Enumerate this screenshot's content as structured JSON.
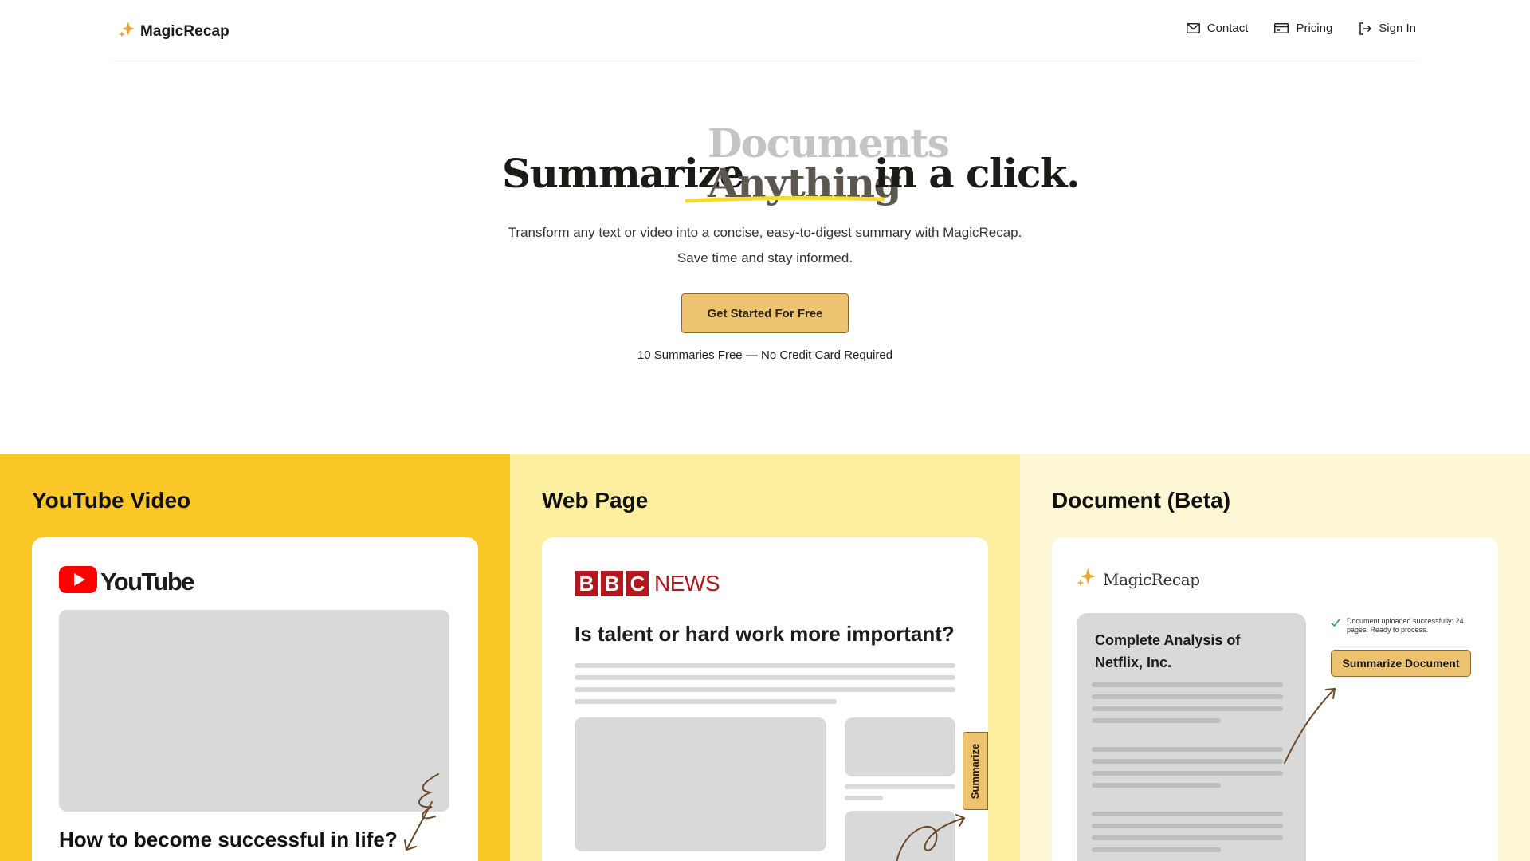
{
  "brand": {
    "name": "MagicRecap"
  },
  "nav": [
    {
      "label": "Contact",
      "icon": "mail-icon"
    },
    {
      "label": "Pricing",
      "icon": "credit-card-icon"
    },
    {
      "label": "Sign In",
      "icon": "sign-in-icon"
    }
  ],
  "hero": {
    "title_left": "Summarize",
    "rotating_prev": "Documents",
    "rotating_current": "Anything",
    "title_right": "in a click.",
    "subtitle_line1": "Transform any text or video into a concise, easy-to-digest summary with MagicRecap.",
    "subtitle_line2": "Save time and stay informed.",
    "cta_label": "Get Started For Free",
    "note": "10 Summaries Free — No Credit Card Required"
  },
  "features": [
    {
      "title": "YouTube Video",
      "logo_text": "YouTube",
      "caption": "How to become successful in life?"
    },
    {
      "title": "Web Page",
      "logo_letters": [
        "B",
        "B",
        "C"
      ],
      "logo_news": "NEWS",
      "article_title": "Is talent or hard work more important?",
      "summarize_tab": "Summarize"
    },
    {
      "title": "Document (Beta)",
      "logo_text": "MagicRecap",
      "doc_title": "Complete Analysis of Netflix, Inc.",
      "upload_message": "Document uploaded successfully: 24 pages. Ready to process.",
      "button_label": "Summarize Document"
    }
  ],
  "colors": {
    "accent": "#edc36f",
    "col1_bg": "#fcc827",
    "col2_bg": "#feeea0",
    "col3_bg": "#fef7d6",
    "youtube_red": "#ff0000",
    "bbc_red": "#b1171c"
  }
}
